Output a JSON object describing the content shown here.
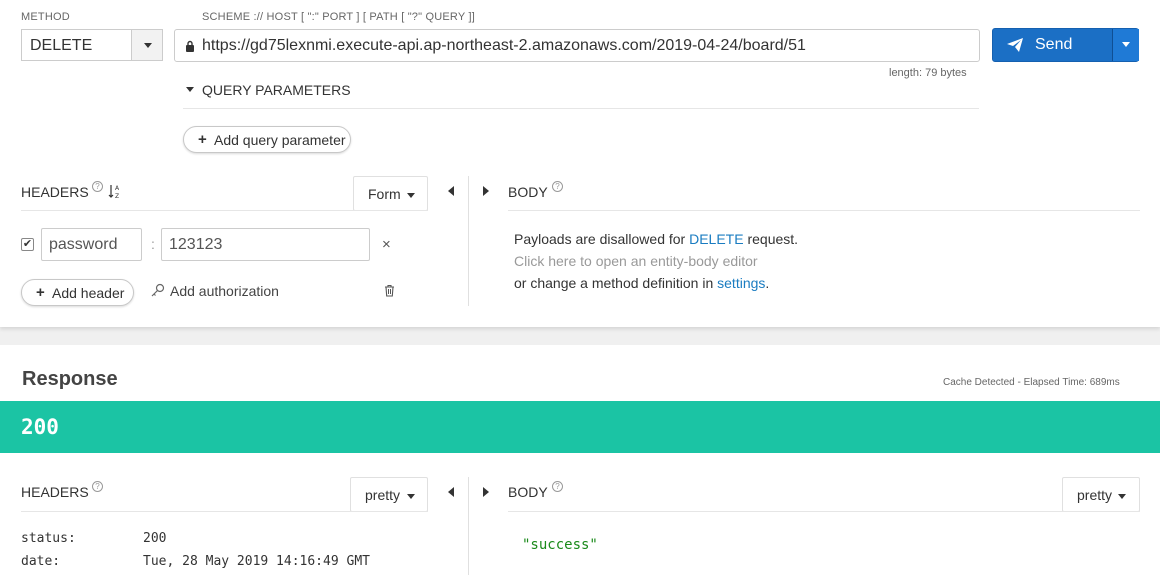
{
  "request": {
    "method_label": "METHOD",
    "method_value": "DELETE",
    "url_label": "SCHEME :// HOST [ \":\" PORT ] [ PATH [ \"?\" QUERY ]]",
    "url_value": "https://gd75lexnmi.execute-api.ap-northeast-2.amazonaws.com/2019-04-24/board/51",
    "send_label": "Send",
    "length_info": "length: 79 bytes",
    "query_params_label": "QUERY PARAMETERS",
    "add_query_param_label": "Add query parameter",
    "headers_label": "HEADERS",
    "headers_mode": "Form",
    "body_label": "BODY",
    "header_rows": [
      {
        "enabled": true,
        "key": "password",
        "value": "123123"
      }
    ],
    "add_header_label": "Add header",
    "add_auth_label": "Add authorization",
    "body_msg": {
      "line1_pre": "Payloads are disallowed for ",
      "line1_method": "DELETE",
      "line1_post": " request.",
      "line2": "Click here to open an entity-body editor",
      "line3_pre": "or change a method definition in ",
      "line3_link": "settings",
      "line3_post": "."
    }
  },
  "response": {
    "title": "Response",
    "cache_info": "Cache Detected - Elapsed Time: 689ms",
    "status_code": "200",
    "status_color": "#1bc4a4",
    "headers_label": "HEADERS",
    "headers_mode": "pretty",
    "body_label": "BODY",
    "body_mode": "pretty",
    "headers": [
      {
        "key": "status:",
        "value": "200"
      },
      {
        "key": "date:",
        "value": "Tue, 28 May 2019 14:16:49 GMT"
      }
    ],
    "body_value": "\"success\""
  },
  "colors": {
    "accent": "#1b6fc5",
    "link": "#1a7cc1",
    "success": "#1bc4a4"
  }
}
